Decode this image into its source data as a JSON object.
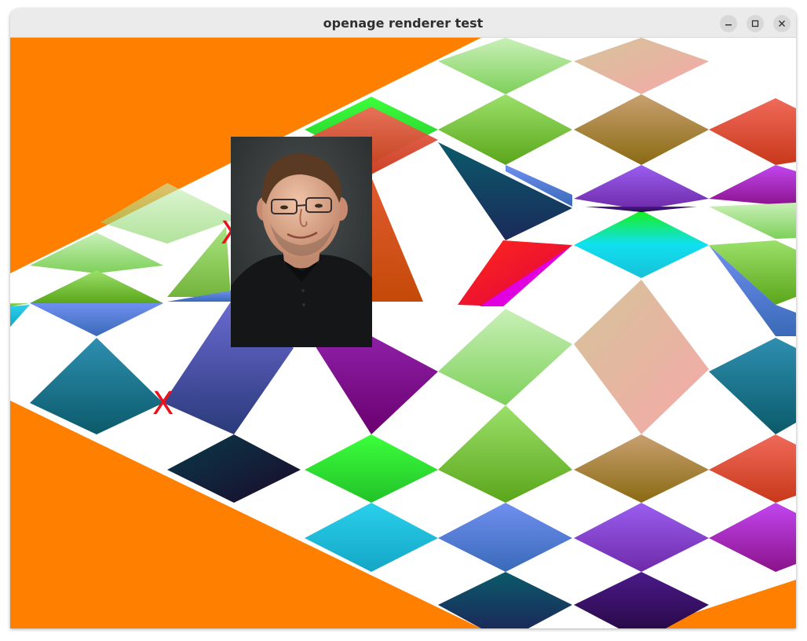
{
  "window": {
    "title": "openage renderer test",
    "controls": {
      "minimize": "minimize-icon",
      "maximize": "maximize-icon",
      "close": "close-icon"
    }
  },
  "scene": {
    "background_color": "#ff8000",
    "markers": [
      "X",
      "X"
    ],
    "marker_color": "#e8131c",
    "sprite": "portrait-photo"
  }
}
